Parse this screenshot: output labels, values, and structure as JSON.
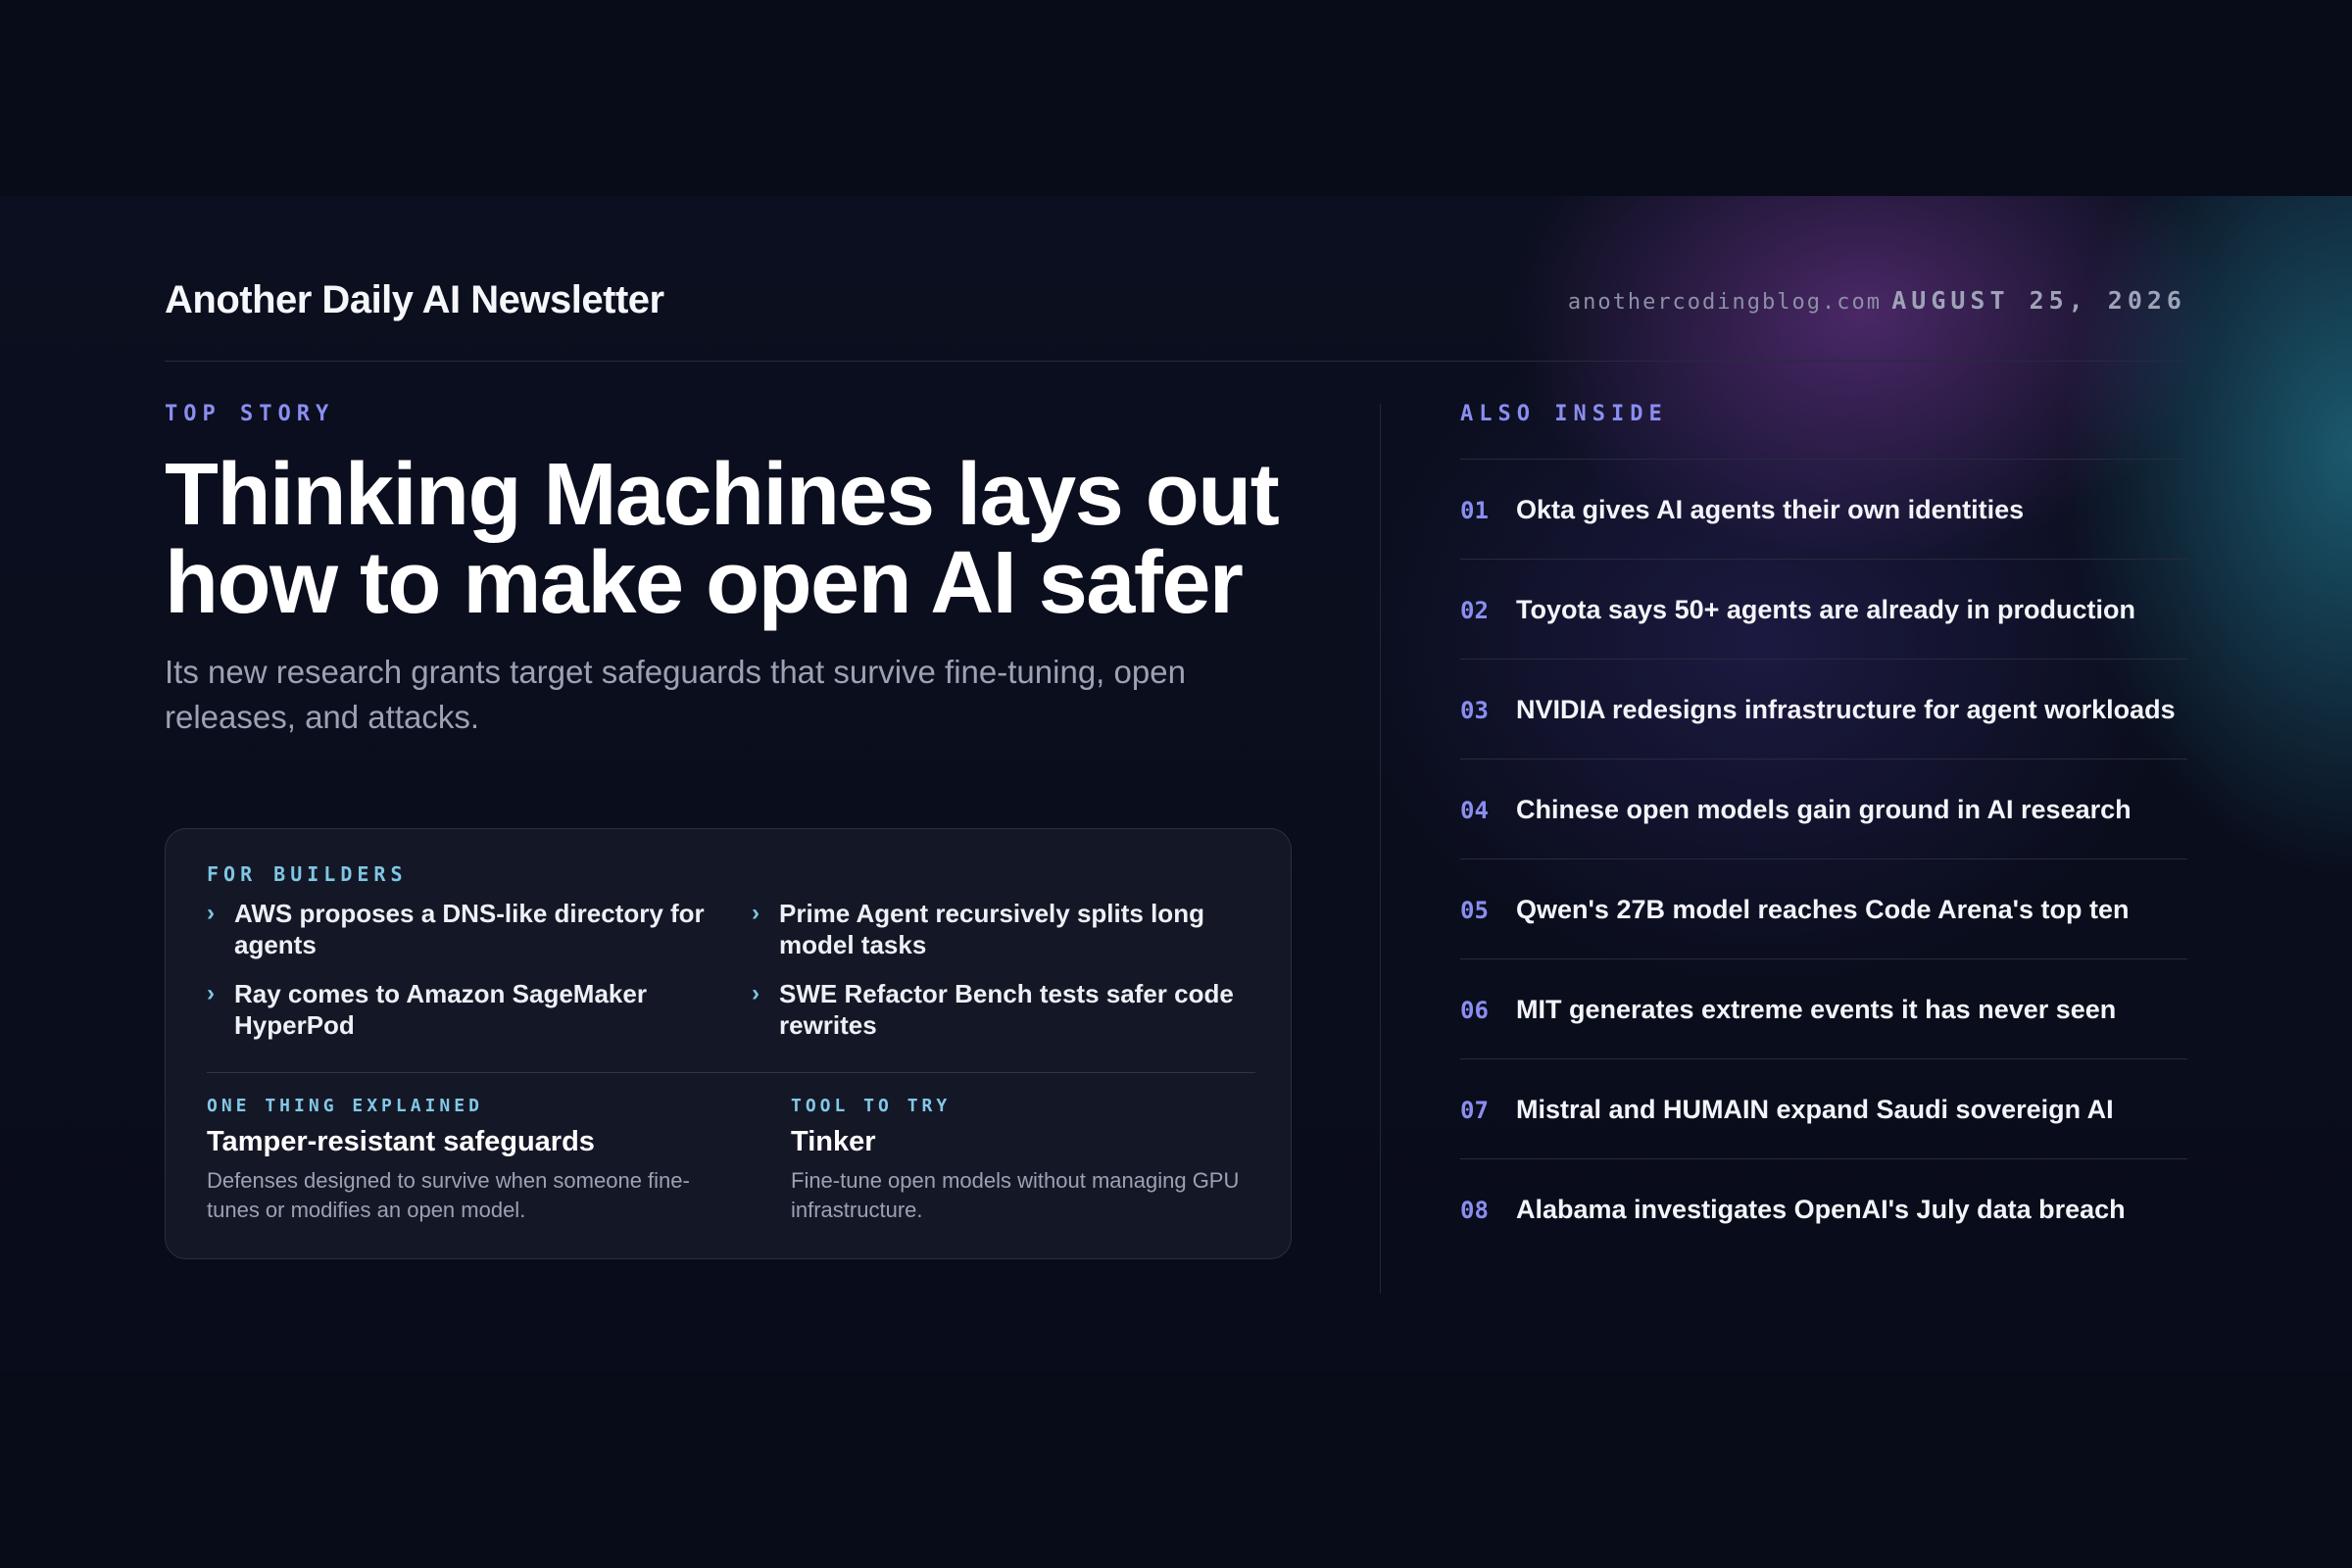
{
  "header": {
    "brand": "Another Daily AI Newsletter",
    "site": "anothercodingblog.com",
    "date": "AUGUST 25, 2026"
  },
  "top_story": {
    "kicker": "TOP STORY",
    "headline_line1": "Thinking Machines lays out",
    "headline_line2": "how to make open AI safer",
    "dek": "Its new research grants target safeguards that survive fine-tuning, open releases, and attacks."
  },
  "builders": {
    "kicker": "FOR BUILDERS",
    "chevron": "›",
    "items": [
      "AWS proposes a DNS-like directory for agents",
      "Prime Agent recursively splits long model tasks",
      "Ray comes to Amazon SageMaker HyperPod",
      "SWE Refactor Bench tests safer code rewrites"
    ],
    "explained": {
      "kicker": "ONE THING EXPLAINED",
      "title": "Tamper-resistant safeguards",
      "desc": "Defenses designed to survive when someone fine-tunes or modifies an open model."
    },
    "tool": {
      "kicker": "TOOL TO TRY",
      "title": "Tinker",
      "desc": "Fine-tune open models without managing GPU infrastructure."
    }
  },
  "also_inside": {
    "kicker": "ALSO INSIDE",
    "items": [
      {
        "num": "01",
        "text": "Okta gives AI agents their own identities"
      },
      {
        "num": "02",
        "text": "Toyota says 50+ agents are already in production"
      },
      {
        "num": "03",
        "text": "NVIDIA redesigns infrastructure for agent workloads"
      },
      {
        "num": "04",
        "text": "Chinese open models gain ground in AI research"
      },
      {
        "num": "05",
        "text": "Qwen's 27B model reaches Code Arena's top ten"
      },
      {
        "num": "06",
        "text": "MIT generates extreme events it has never seen"
      },
      {
        "num": "07",
        "text": "Mistral and HUMAIN expand Saudi sovereign AI"
      },
      {
        "num": "08",
        "text": "Alabama investigates OpenAI's July data breach"
      }
    ]
  },
  "colors": {
    "accent_purple": "#8a8ef0",
    "accent_cyan": "#7fc6e4",
    "background": "#080b18"
  }
}
